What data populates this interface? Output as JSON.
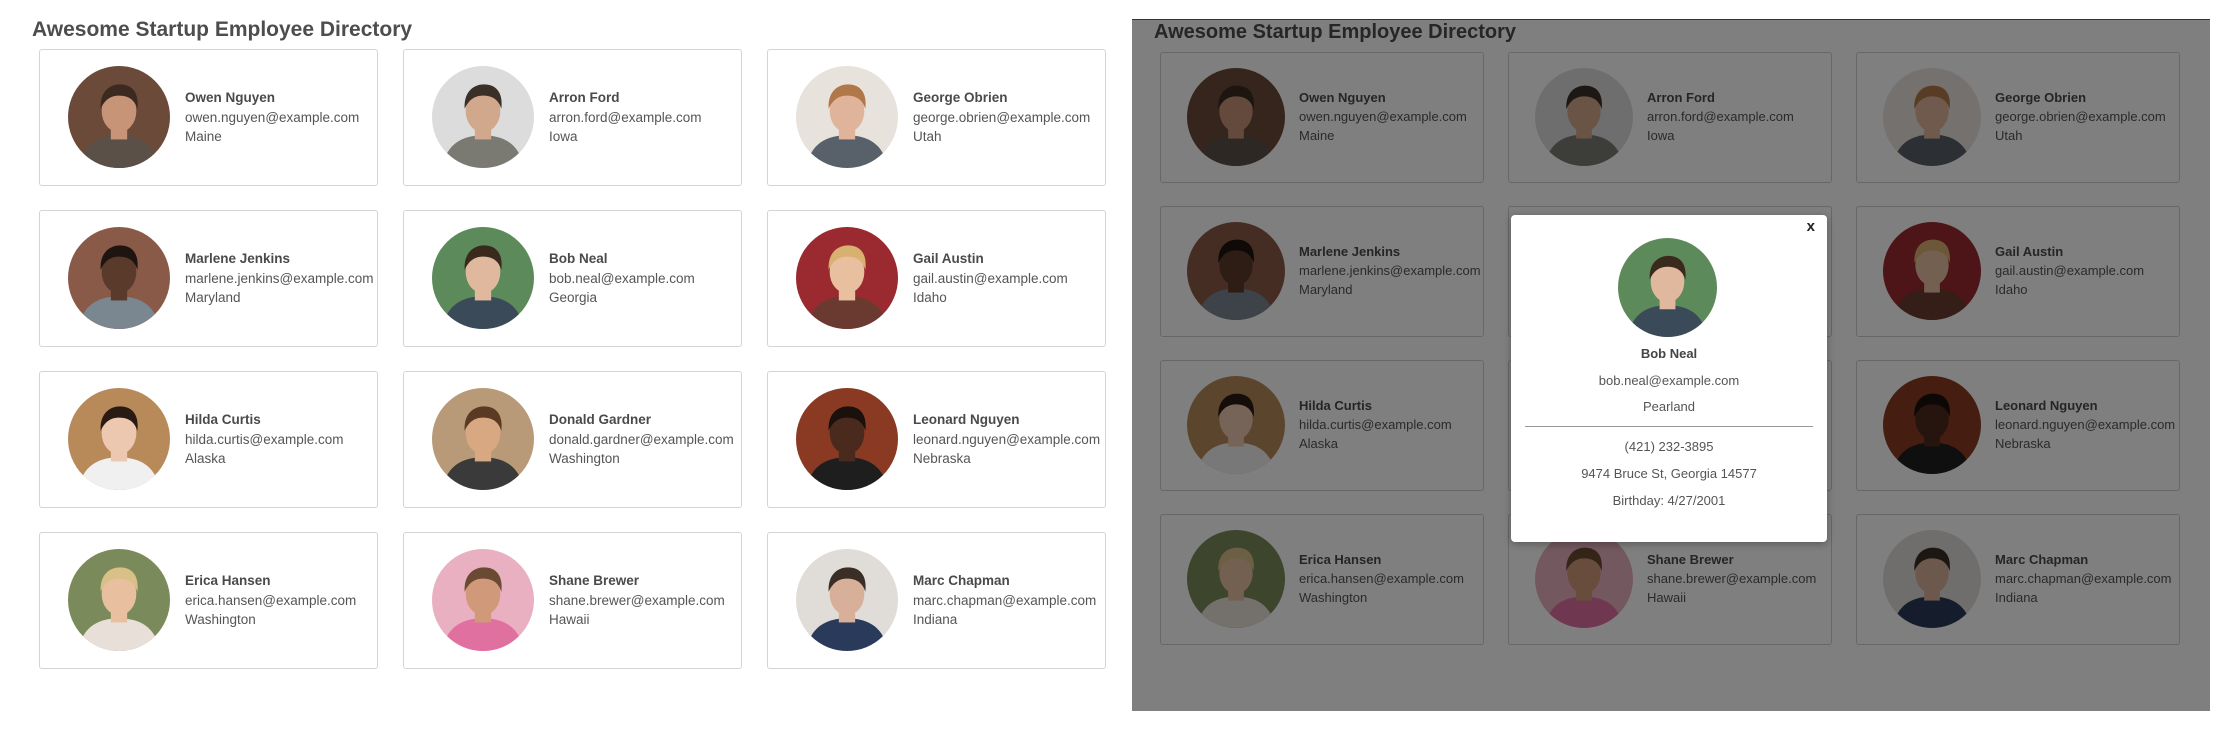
{
  "left": {
    "title": "Awesome Startup Employee Directory"
  },
  "right": {
    "title": "Awesome Startup Employee Directory"
  },
  "employees": [
    {
      "name": "Owen Nguyen",
      "email": "owen.nguyen@example.com",
      "location": "Maine",
      "avatar": "portrait-photo-icon",
      "palette": {
        "bg": "#6b4a3a",
        "skin": "#c89478",
        "hair": "#3a2a20",
        "shirt": "#5a5048"
      }
    },
    {
      "name": "Arron Ford",
      "email": "arron.ford@example.com",
      "location": "Iowa",
      "avatar": "portrait-photo-icon",
      "palette": {
        "bg": "#dcdcdc",
        "skin": "#d2a88c",
        "hair": "#3a3028",
        "shirt": "#7a7a72"
      }
    },
    {
      "name": "George Obrien",
      "email": "george.obrien@example.com",
      "location": "Utah",
      "avatar": "portrait-photo-icon",
      "palette": {
        "bg": "#e8e2dc",
        "skin": "#e0b49a",
        "hair": "#b07848",
        "shirt": "#58606a"
      }
    },
    {
      "name": "Marlene Jenkins",
      "email": "marlene.jenkins@example.com",
      "location": "Maryland",
      "avatar": "portrait-photo-icon",
      "palette": {
        "bg": "#8a5a48",
        "skin": "#5a3a2a",
        "hair": "#1e1410",
        "shirt": "#7a8690"
      }
    },
    {
      "name": "Bob Neal",
      "email": "bob.neal@example.com",
      "location": "Georgia",
      "avatar": "portrait-photo-icon",
      "palette": {
        "bg": "#5d8a5a",
        "skin": "#e0b89e",
        "hair": "#3a2a1e",
        "shirt": "#3a4a58"
      }
    },
    {
      "name": "Gail Austin",
      "email": "gail.austin@example.com",
      "location": "Idaho",
      "avatar": "portrait-photo-icon",
      "palette": {
        "bg": "#9a2a30",
        "skin": "#e8c0a0",
        "hair": "#d8b070",
        "shirt": "#6a3a30"
      }
    },
    {
      "name": "Hilda Curtis",
      "email": "hilda.curtis@example.com",
      "location": "Alaska",
      "avatar": "portrait-photo-icon",
      "palette": {
        "bg": "#b88a5a",
        "skin": "#ecc8b0",
        "hair": "#2a1a14",
        "shirt": "#f0f0f0"
      }
    },
    {
      "name": "Donald Gardner",
      "email": "donald.gardner@example.com",
      "location": "Washington",
      "avatar": "portrait-photo-icon",
      "palette": {
        "bg": "#b89a78",
        "skin": "#d8a882",
        "hair": "#5a3a22",
        "shirt": "#3a3a3a"
      }
    },
    {
      "name": "Leonard Nguyen",
      "email": "leonard.nguyen@example.com",
      "location": "Nebraska",
      "avatar": "portrait-photo-icon",
      "palette": {
        "bg": "#8a3a22",
        "skin": "#4a2a1c",
        "hair": "#1a100c",
        "shirt": "#1e1e1e"
      }
    },
    {
      "name": "Erica Hansen",
      "email": "erica.hansen@example.com",
      "location": "Washington",
      "avatar": "portrait-photo-icon",
      "palette": {
        "bg": "#7a8a5a",
        "skin": "#e8c0a0",
        "hair": "#d8c088",
        "shirt": "#e8e0d8"
      }
    },
    {
      "name": "Shane Brewer",
      "email": "shane.brewer@example.com",
      "location": "Hawaii",
      "avatar": "portrait-photo-icon",
      "palette": {
        "bg": "#e8b0c0",
        "skin": "#d09a7a",
        "hair": "#6a4a32",
        "shirt": "#e070a0"
      }
    },
    {
      "name": "Marc Chapman",
      "email": "marc.chapman@example.com",
      "location": "Indiana",
      "avatar": "portrait-photo-icon",
      "palette": {
        "bg": "#e0dcd8",
        "skin": "#d8b09a",
        "hair": "#3a2e26",
        "shirt": "#2a3a5a"
      }
    }
  ],
  "modal": {
    "close_label": "x",
    "name": "Bob Neal",
    "email": "bob.neal@example.com",
    "city": "Pearland",
    "phone": "(421) 232-3895",
    "address": "9474 Bruce St, Georgia 14577",
    "birthday": "Birthday: 4/27/2001",
    "avatar": "portrait-photo-icon",
    "palette": {
      "bg": "#5d8a5a",
      "skin": "#e0b89e",
      "hair": "#3a2a1e",
      "shirt": "#3a4a58"
    }
  },
  "overlay_color": "rgba(0,0,0,0.5)"
}
